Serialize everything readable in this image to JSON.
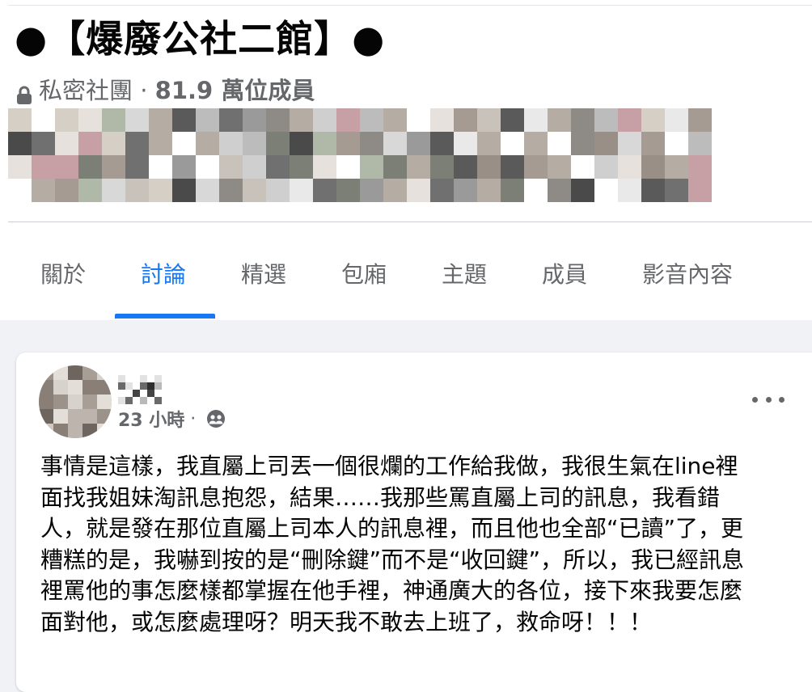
{
  "group": {
    "title": "●【爆廢公社二館】●",
    "privacy": "私密社團",
    "separator": " · ",
    "members": "81.9 萬位成員"
  },
  "tabs": [
    {
      "label": "關於"
    },
    {
      "label": "討論"
    },
    {
      "label": "精選"
    },
    {
      "label": "包廂"
    },
    {
      "label": "主題"
    },
    {
      "label": "成員"
    },
    {
      "label": "影音內容"
    }
  ],
  "post": {
    "time": "23 小時",
    "separator": " · ",
    "body_lines": [
      "事情是這樣，我直屬上司丟一個很爛的工作給我做，我很生氣在line裡",
      "面找我姐妹淘訊息抱怨，結果……我那些罵直屬上司的訊息，我看錯",
      "人，就是發在那位直屬上司本人的訊息裡，而且他也全部“已讀”了，更",
      "糟糕的是，我嚇到按的是“刪除鍵”而不是“收回鍵”，所以，我已經訊息",
      "裡罵他的事怎麼樣都掌握在他手裡，神通廣大的各位，接下來我要怎麼",
      "面對他，或怎麼處理呀？明天我不敢去上班了，救命呀！！！"
    ]
  },
  "icons": {
    "lock": "lock-icon",
    "privacy": "group-members-icon",
    "more": "more-options-icon"
  },
  "colors": {
    "accent": "#1877f2",
    "secondary_text": "#65676b",
    "background": "#f0f2f5"
  }
}
